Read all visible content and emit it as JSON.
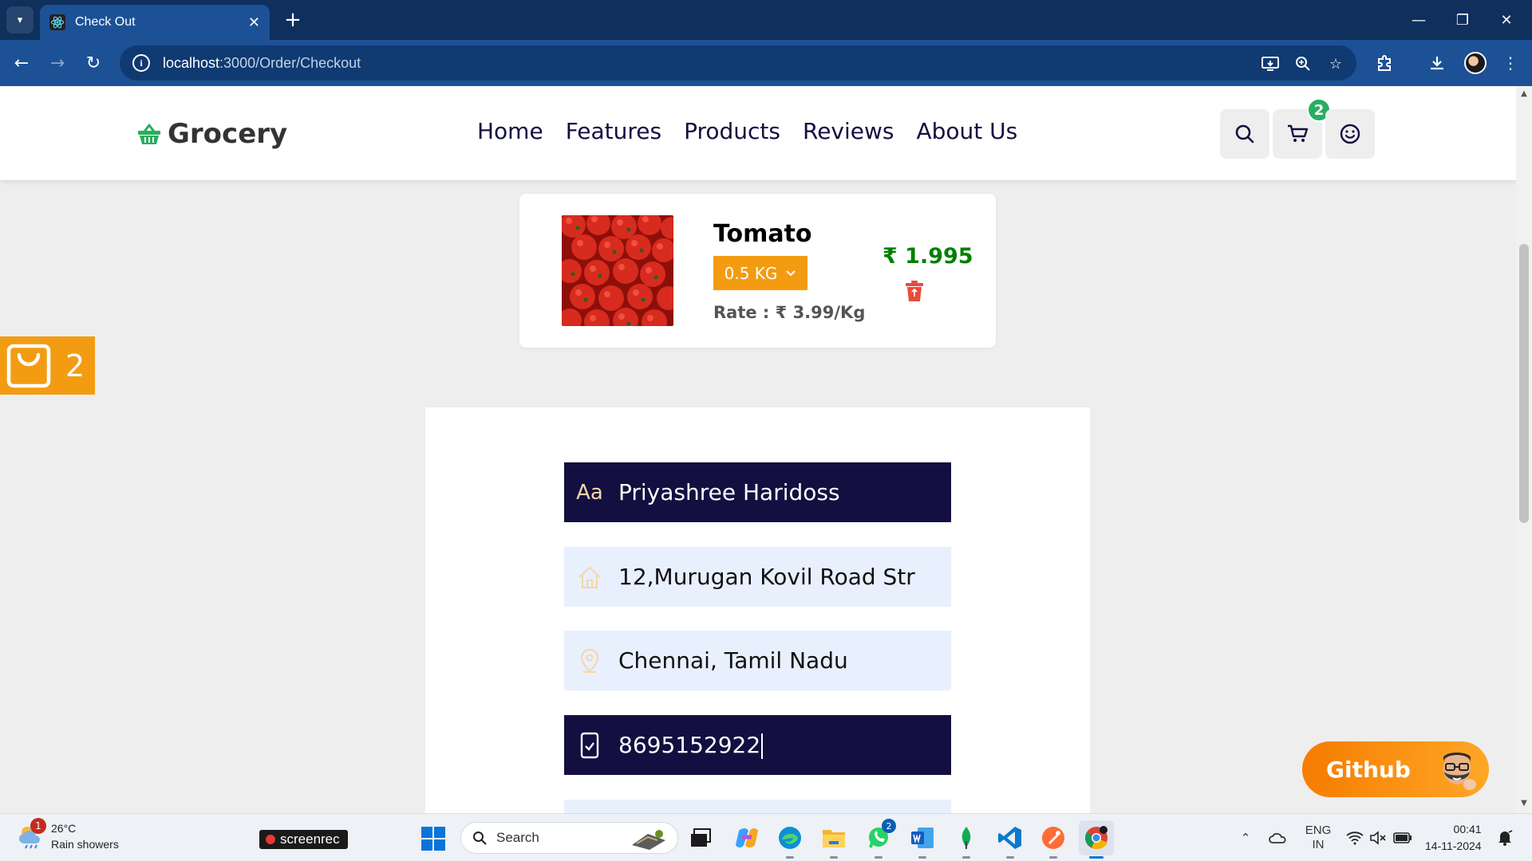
{
  "browser": {
    "tab_title": "Check Out",
    "url_host": "localhost",
    "url_path": ":3000/Order/Checkout"
  },
  "header": {
    "brand": "Grocery",
    "nav": [
      "Home",
      "Features",
      "Products",
      "Reviews",
      "About Us"
    ],
    "cart_count": "2"
  },
  "cart_item": {
    "name": "Tomato",
    "quantity": "0.5 KG",
    "rate": "Rate : ₹ 3.99/Kg",
    "price": "₹ 1.995"
  },
  "side_cart": {
    "count": "2"
  },
  "form": {
    "name": "Priyashree Haridoss",
    "address": "12,Murugan Kovil Road Str",
    "city": "Chennai, Tamil Nadu",
    "phone": "8695152922",
    "name_icon_text": "Aa"
  },
  "github_button": {
    "label": "Github"
  },
  "taskbar": {
    "weather_temp": "26°C",
    "weather_desc": "Rain showers",
    "weather_badge": "1",
    "screenrec": "screenrec",
    "search_label": "Search",
    "whatsapp_badge": "2",
    "lang_line1": "ENG",
    "lang_line2": "IN",
    "time": "00:41",
    "date": "14-11-2024"
  },
  "colors": {
    "brand_green": "#008000",
    "accent_orange": "#f39c12",
    "dark_navy": "#130f40",
    "light_field": "#e8f0fe"
  },
  "icons": {
    "logo": "shopping-basket-icon",
    "search": "search-icon",
    "cart": "cart-icon",
    "user": "smile-icon",
    "delete": "trash-icon",
    "address": "home-icon",
    "city": "location-pin-icon",
    "phone": "phone-icon"
  }
}
